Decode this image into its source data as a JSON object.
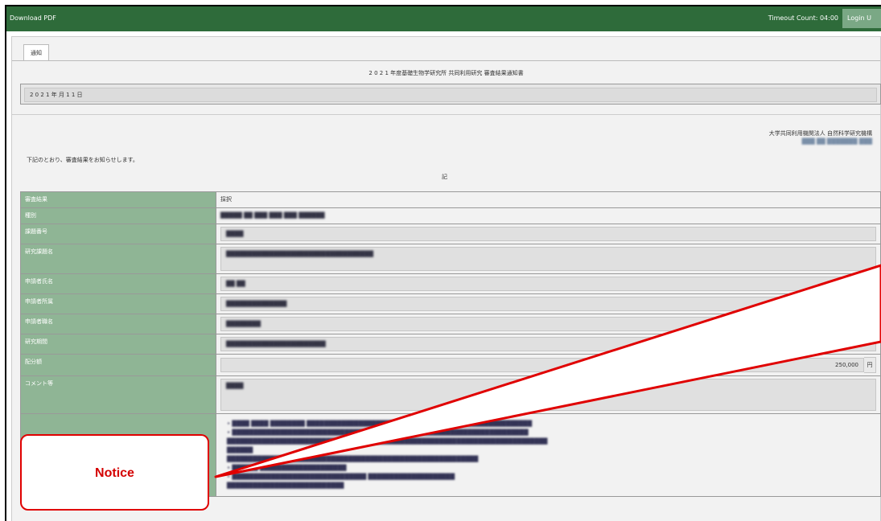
{
  "topbar": {
    "download_label": "Download PDF",
    "timeout_label": "Timeout Count: 04:00",
    "login_label": "Login U"
  },
  "tabs": [
    {
      "label": "通知"
    }
  ],
  "document": {
    "title": "2 0 2 1 年度基礎生物学研究所 共同利用研究 審査結果通知書",
    "date": "2 0 2 1 年 月 1 1 日",
    "org_line1": "大学共同利用機関法人 自然科学研究機構",
    "org_line2": "███ ██ ███████ ███",
    "intro": "下記のとおり、審査結果をお知らせします。",
    "ki": "記"
  },
  "rows": [
    {
      "label": "審査結果",
      "value": "採択"
    },
    {
      "label": "種別",
      "value": "█████ ██ ███ ███ ███ ██████"
    },
    {
      "label": "課題番号",
      "value": "████"
    },
    {
      "label": "研究課題名",
      "value": "██████████████████████████████████"
    },
    {
      "label": "申請者氏名",
      "value": "██ ██"
    },
    {
      "label": "申請者所属",
      "value": "██████████████"
    },
    {
      "label": "申請者職名",
      "value": "████████"
    },
    {
      "label": "研究期間",
      "value": "███████████████████████"
    },
    {
      "label": "配分額",
      "value": "250,000",
      "unit": "円"
    },
    {
      "label": "コメント等",
      "value": "████"
    }
  ],
  "notes": [
    "• ████ ████ ████████ ████████████████████████████████████████████████████",
    "• ████████████████████████████████████ ████████████████████████████████",
    "  ██████████████████████████████████████████████████████████████████████████",
    "  ██████",
    "  ██████████████████████████████████████████████████████████",
    "• ██████ ████████████████████",
    "• ███████████████████████████████ ████████████████████",
    "  ███████████████████████████"
  ],
  "callout": {
    "label": "Notice",
    "accent": "#e00000"
  }
}
